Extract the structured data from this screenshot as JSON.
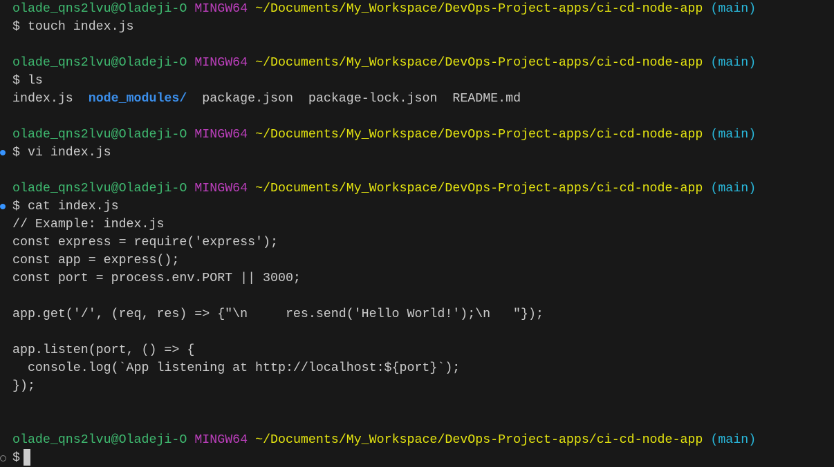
{
  "prompt": {
    "user": "olade_qns2lvu@Oladeji-O",
    "system": "MINGW64",
    "path": "~/Documents/My_Workspace/DevOps-Project-apps/ci-cd-node-app",
    "branch": "(main)"
  },
  "commands": [
    "$ touch index.js",
    "$ ls",
    "$ vi index.js",
    "$ cat index.js",
    "$"
  ],
  "ls_output": {
    "file1": "index.js",
    "dir": "node_modules/",
    "file2": "package.json",
    "file3": "package-lock.json",
    "file4": "README.md"
  },
  "file_content": [
    "// Example: index.js",
    "const express = require('express');",
    "const app = express();",
    "const port = process.env.PORT || 3000;",
    "",
    "app.get('/', (req, res) => {\"\\n     res.send('Hello World!');\\n   \"});",
    "",
    "app.listen(port, () => {",
    "  console.log(`App listening at http://localhost:${port}`);",
    "});"
  ]
}
